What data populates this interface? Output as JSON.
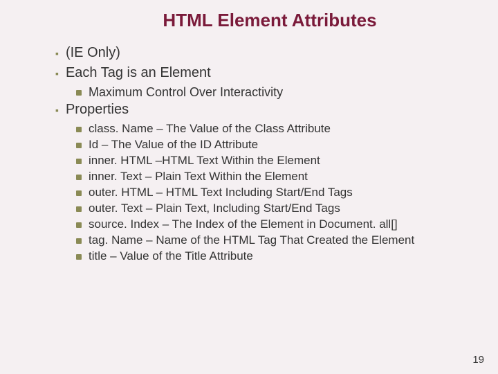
{
  "title": "HTML Element Attributes",
  "bullets_l1": [
    "(IE Only)",
    "Each Tag is an Element"
  ],
  "bullets_l2_a": [
    "Maximum Control Over Interactivity"
  ],
  "bullets_l1_b": [
    "Properties"
  ],
  "bullets_l3": [
    "class. Name – The Value of the Class Attribute",
    "Id – The Value of the ID Attribute",
    "inner. HTML –HTML Text Within the Element",
    "inner. Text – Plain Text Within the Element",
    "outer. HTML – HTML Text Including Start/End Tags",
    "outer. Text – Plain Text, Including Start/End Tags",
    "source. Index – The Index of the Element in Document. all[]",
    "tag. Name – Name of the HTML Tag That Created the Element",
    "title – Value of the Title Attribute"
  ],
  "page_number": "19"
}
